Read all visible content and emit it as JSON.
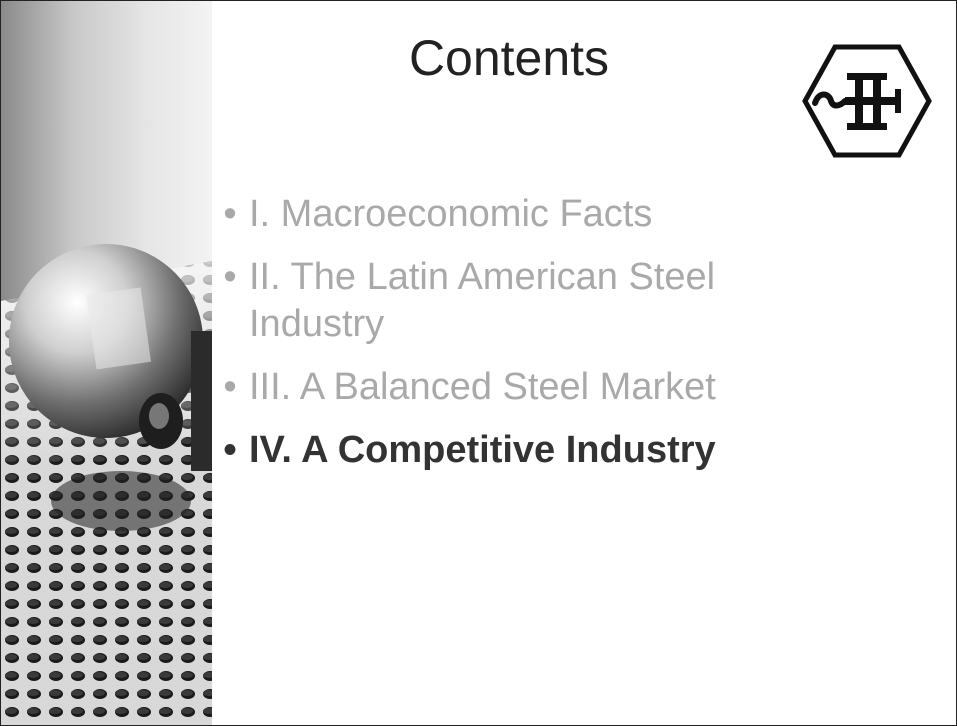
{
  "slide": {
    "title": "Contents",
    "items": [
      {
        "bullet": "•",
        "label": "I. Macroeconomic Facts",
        "state": "muted"
      },
      {
        "bullet": "•",
        "label": "II. The Latin American Steel Industry",
        "state": "muted"
      },
      {
        "bullet": "•",
        "label": "III. A Balanced Steel Market",
        "state": "muted"
      },
      {
        "bullet": "•",
        "label": "IV. A Competitive Industry",
        "state": "current"
      }
    ],
    "colors": {
      "muted_text": "#a9a9a9",
      "current_text": "#333333",
      "title_text": "#222222"
    },
    "logo_icon": "hexagon-h-logo-icon",
    "side_image": "steel-sphere-on-perforated-sheet-photo"
  }
}
